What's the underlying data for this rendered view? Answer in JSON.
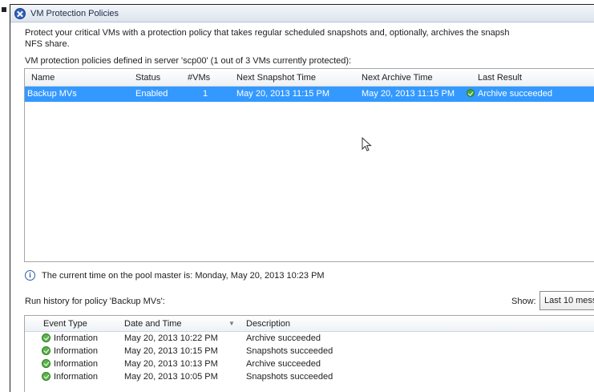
{
  "window": {
    "title": "VM Protection Policies"
  },
  "description": {
    "line1": "Protect your critical VMs with a protection policy that takes regular scheduled snapshots and, optionally, archives the snapsh",
    "line2": "NFS share."
  },
  "policies_label": "VM protection policies defined in server 'scp00' (1 out of 3 VMs currently protected):",
  "policies_table": {
    "columns": [
      "Name",
      "Status",
      "#VMs",
      "Next Snapshot Time",
      "Next Archive Time",
      "Last Result"
    ],
    "rows": [
      {
        "name": "Backup MVs",
        "status": "Enabled",
        "vms": "1",
        "next_snapshot": "May 20, 2013 11:15 PM",
        "next_archive": "May 20, 2013 11:15 PM",
        "last_result": "Archive succeeded",
        "selected": true
      }
    ]
  },
  "current_time_text": "The current time on the pool master is: Monday, May 20, 2013 10:23 PM",
  "history_label": "Run history for policy 'Backup MVs':",
  "show": {
    "label": "Show:",
    "selected": "Last 10 mess"
  },
  "history_table": {
    "columns": [
      "Event Type",
      "Date and Time",
      "Description"
    ],
    "rows": [
      {
        "event_type": "Information",
        "date_time": "May 20, 2013 10:22 PM",
        "description": "Archive succeeded"
      },
      {
        "event_type": "Information",
        "date_time": "May 20, 2013 10:15 PM",
        "description": "Snapshots succeeded"
      },
      {
        "event_type": "Information",
        "date_time": "May 20, 2013 10:13 PM",
        "description": "Archive succeeded"
      },
      {
        "event_type": "Information",
        "date_time": "May 20, 2013 10:05 PM",
        "description": "Snapshots succeeded"
      }
    ]
  },
  "colors": {
    "selection": "#3399ff",
    "success": "#49a63b",
    "title_icon": "#2f62b8"
  },
  "icons": {
    "title": "close-circle-icon",
    "result": "checkmark-icon",
    "info": "info-icon",
    "event": "checkmark-icon"
  }
}
